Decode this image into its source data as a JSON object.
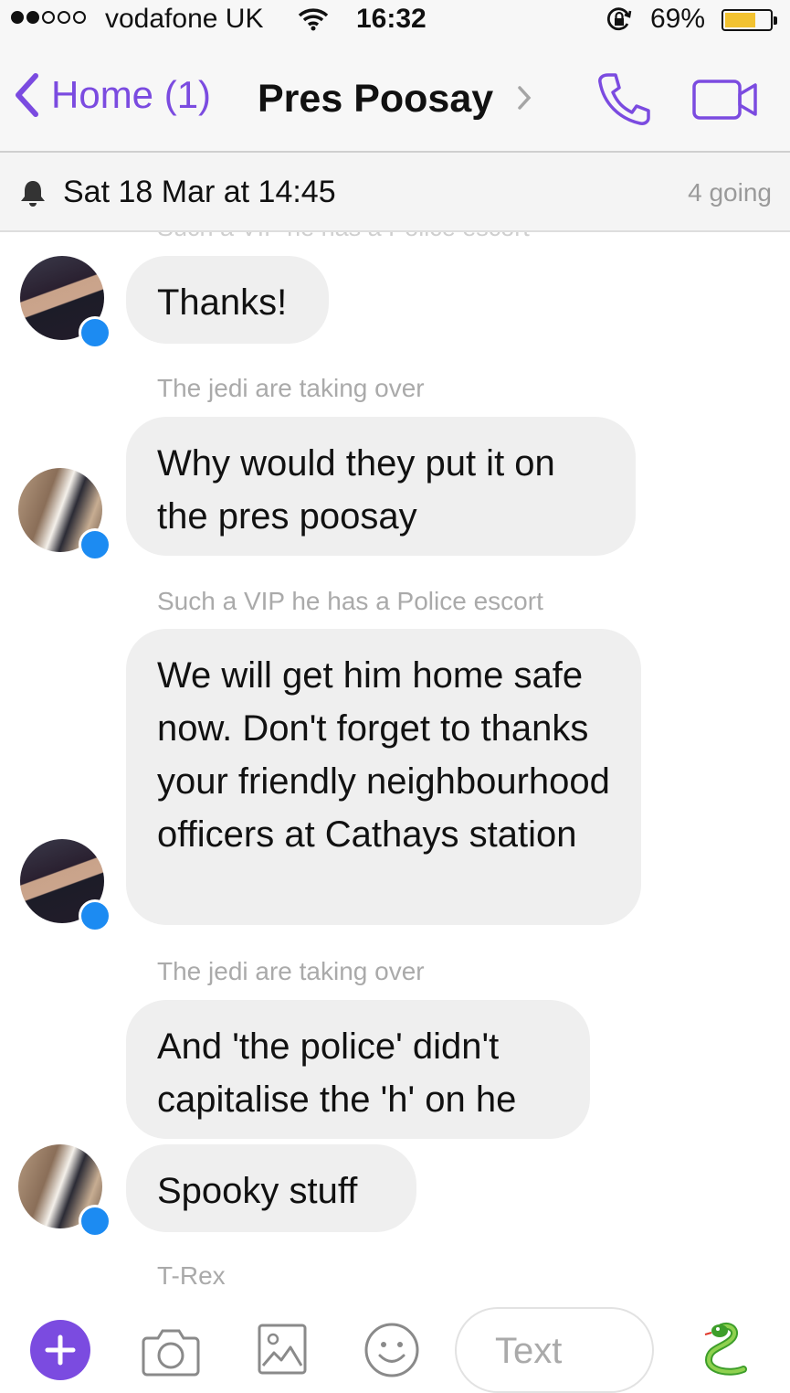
{
  "status_bar": {
    "carrier": "vodafone UK",
    "time": "16:32",
    "battery": "69%",
    "battery_level": 0.69
  },
  "nav": {
    "back_label": "Home (1)",
    "title": "Pres Poosay"
  },
  "event": {
    "date": "Sat 18 Mar at 14:45",
    "going": "4 going"
  },
  "messages": {
    "ghost_caption": "Such a VIP he has a Police escort",
    "m1": "Thanks!",
    "c2": "The jedi are taking over",
    "m2": "Why would they put it on the pres poosay",
    "c3": "Such a VIP he has a Police escort",
    "m3": "We will get him home safe now.  Don't forget to thanks your friendly neighbourhood officers at Cathays station",
    "c4": "The jedi are taking over",
    "m4": "And 'the police' didn't capitalise the 'h' on he",
    "m5": "Spooky stuff",
    "c6": "T-Rex"
  },
  "composer": {
    "placeholder": "Text"
  },
  "colors": {
    "accent": "#7b4be0",
    "bubble": "#efefef",
    "messenger_badge": "#1c8bf2",
    "battery_fill": "#f2c230"
  }
}
